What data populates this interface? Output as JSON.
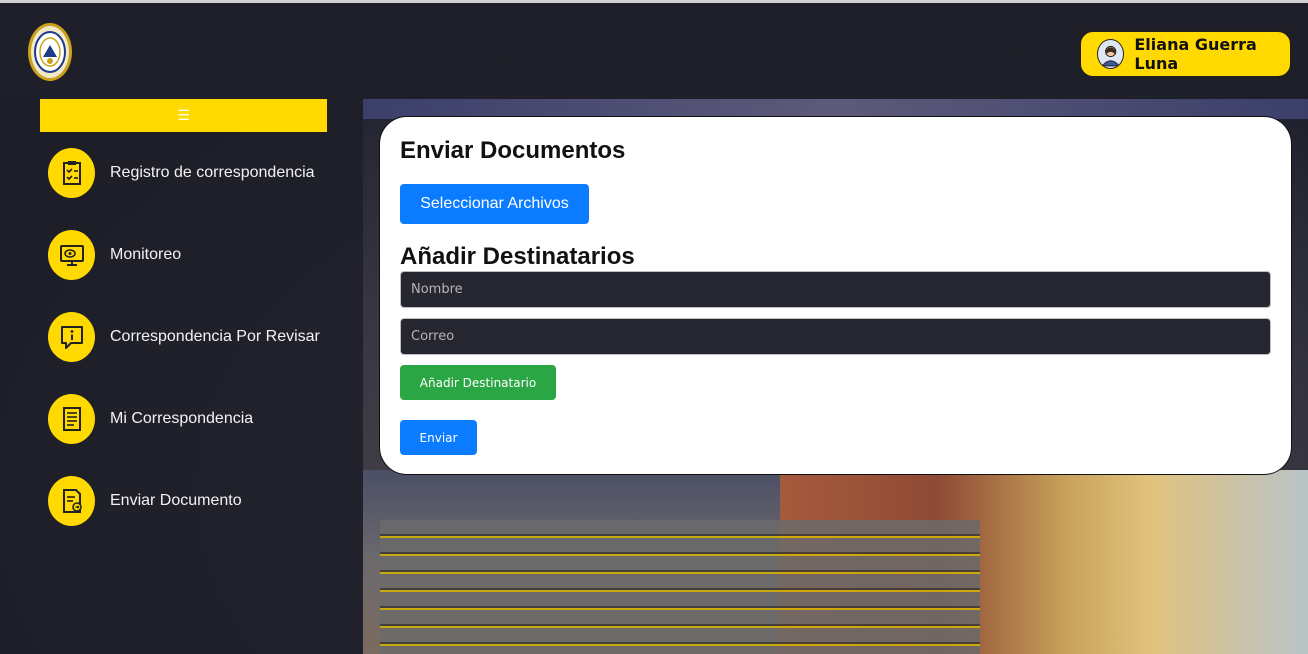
{
  "header": {
    "logo_icon": "university-seal-icon",
    "user": {
      "name": "Eliana Guerra Luna",
      "avatar_icon": "user-avatar-icon"
    }
  },
  "sidebar": {
    "toggle_label": "☰",
    "items": [
      {
        "label": "Registro de correspondencia",
        "icon": "clipboard-checklist-icon"
      },
      {
        "label": "Monitoreo",
        "icon": "monitor-eye-icon"
      },
      {
        "label": "Correspondencia Por Revisar",
        "icon": "info-message-icon"
      },
      {
        "label": "Mi Correspondencia",
        "icon": "document-list-icon"
      },
      {
        "label": "Enviar Documento",
        "icon": "document-send-icon"
      }
    ]
  },
  "form": {
    "title": "Enviar Documentos",
    "select_files_label": "Seleccionar Archivos",
    "recipients_title": "Añadir Destinatarios",
    "name_placeholder": "Nombre",
    "email_placeholder": "Correo",
    "add_recipient_label": "Añadir Destinatario",
    "send_label": "Enviar"
  },
  "colors": {
    "accent_yellow": "#ffd900",
    "primary_blue": "#0b7bff",
    "success_green": "#2aa744",
    "dark_bg": "#1f2028"
  }
}
